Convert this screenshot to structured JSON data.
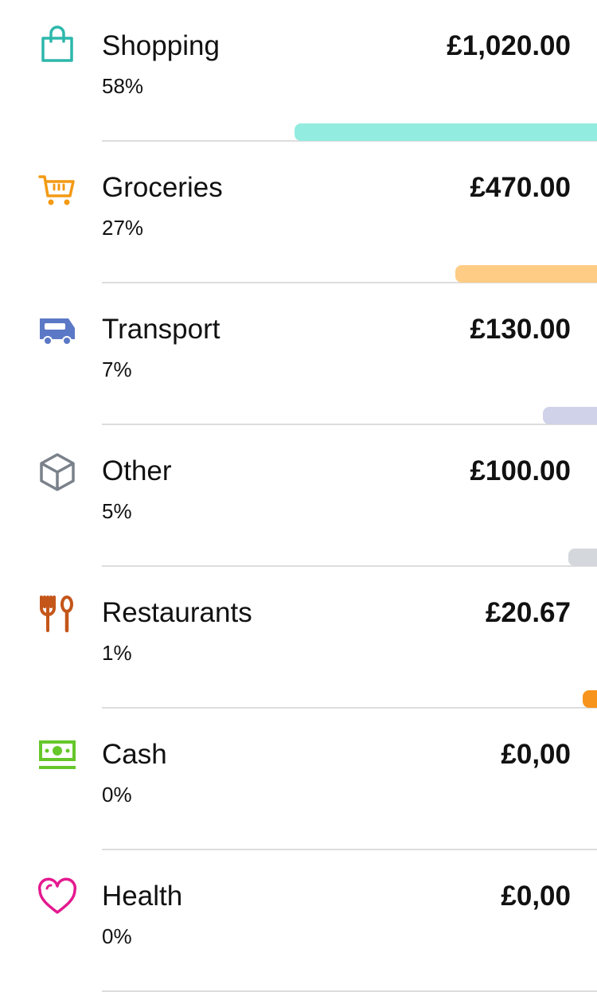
{
  "categories": [
    {
      "name": "Shopping",
      "percent_label": "58%",
      "amount": "£1,020.00",
      "share": 0.507,
      "icon": "shopping-bag-icon",
      "color": "#93ece0",
      "icon_color": "#2db7ac"
    },
    {
      "name": "Groceries",
      "percent_label": "27%",
      "amount": "£470.00",
      "share": 0.237,
      "icon": "shopping-cart-icon",
      "color": "#ffcc85",
      "icon_color": "#f39a14"
    },
    {
      "name": "Transport",
      "percent_label": "7%",
      "amount": "£130.00",
      "share": 0.091,
      "icon": "bus-icon",
      "color": "#cfd2e8",
      "icon_color": "#5b78c6"
    },
    {
      "name": "Other",
      "percent_label": "5%",
      "amount": "£100.00",
      "share": 0.048,
      "icon": "box-icon",
      "color": "#d4d7db",
      "icon_color": "#7a818a"
    },
    {
      "name": "Restaurants",
      "percent_label": "1%",
      "amount": "£20.67",
      "share": 0.024,
      "icon": "fork-spoon-icon",
      "color": "#f7941d",
      "icon_color": "#c4561a"
    },
    {
      "name": "Cash",
      "percent_label": "0%",
      "amount": "£0,00",
      "share": 0,
      "icon": "cash-icon",
      "color": "#7ed321",
      "icon_color": "#66c72a"
    },
    {
      "name": "Health",
      "percent_label": "0%",
      "amount": "£0,00",
      "share": 0,
      "icon": "heart-icon",
      "color": "#e91e8c",
      "icon_color": "#e4198f"
    }
  ]
}
